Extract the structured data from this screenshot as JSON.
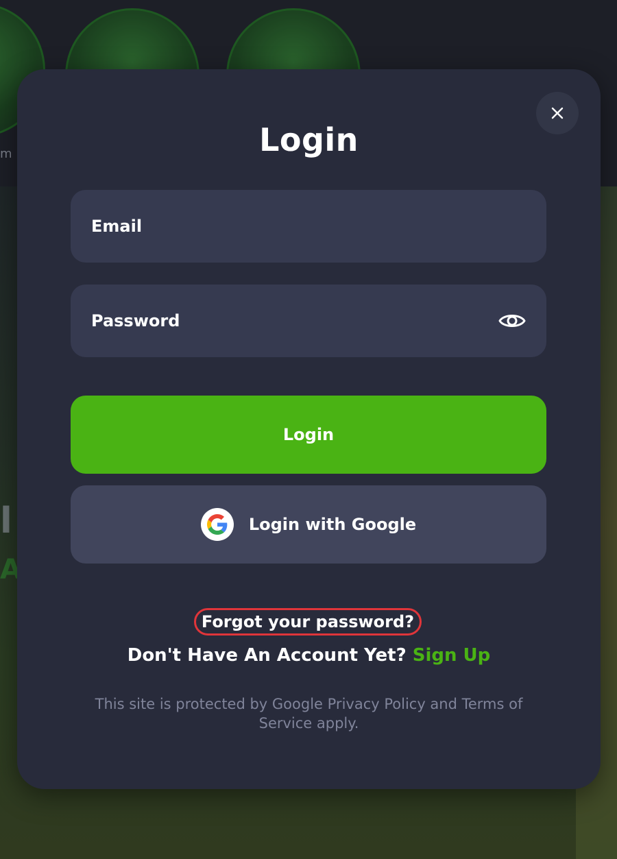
{
  "background": {
    "thumb_caption": "m",
    "letter_1": "l",
    "letter_2": "A"
  },
  "modal": {
    "title": "Login",
    "close_icon": "close-icon",
    "email": {
      "placeholder": "Email",
      "value": ""
    },
    "password": {
      "placeholder": "Password",
      "value": "",
      "toggle_icon": "eye-icon"
    },
    "login_button": "Login",
    "google_button": {
      "label": "Login with Google",
      "icon": "google-icon"
    },
    "forgot_password": "Forgot your password?",
    "signup_prompt": "Don't Have An Account Yet?",
    "signup_link": "Sign Up",
    "legal_text": "This site is protected by Google Privacy Policy and Terms of Service apply."
  },
  "colors": {
    "accent_green": "#4ab314",
    "modal_bg": "#282b3b",
    "field_bg": "#363a50",
    "google_btn_bg": "#41455c",
    "highlight_border": "#e0353a"
  }
}
